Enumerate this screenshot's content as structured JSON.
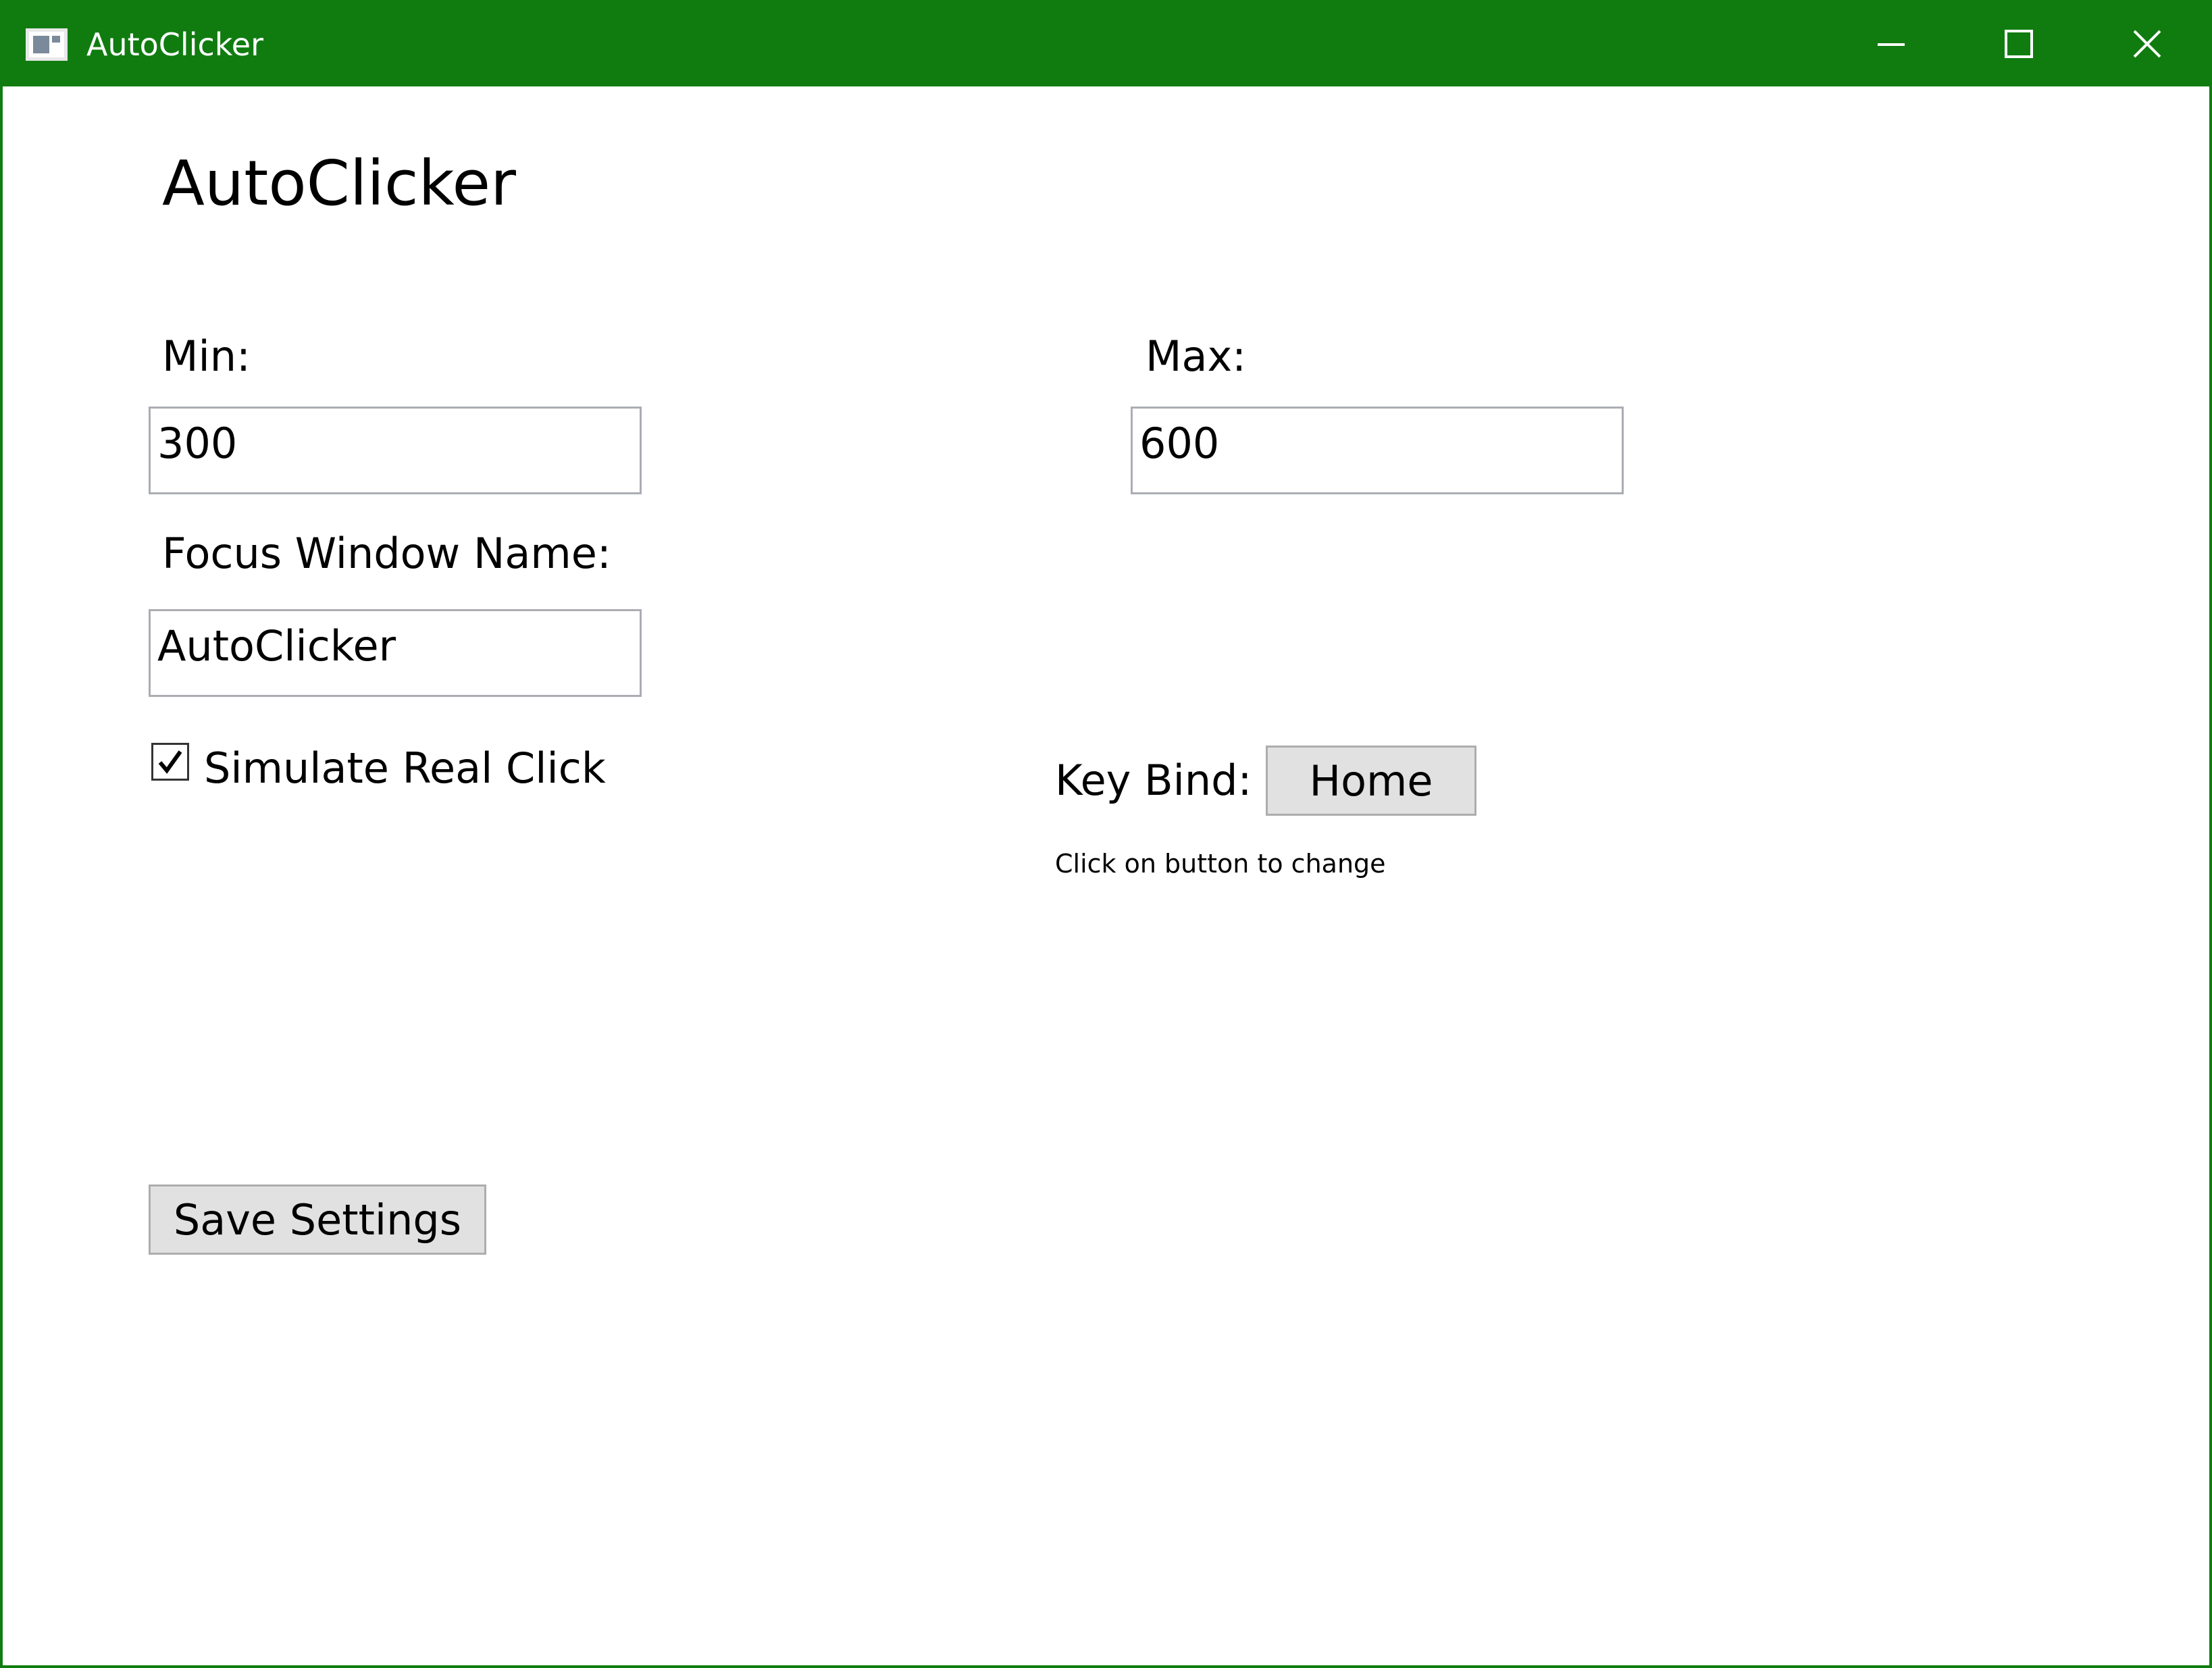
{
  "window": {
    "title": "AutoClicker",
    "app_icon": "window-app-icon",
    "controls": {
      "minimize_icon": "minimize-icon",
      "maximize_icon": "maximize-icon",
      "close_icon": "close-icon"
    },
    "titlebar_color": "#107c10"
  },
  "main": {
    "heading": "AutoClicker",
    "min": {
      "label": "Min:",
      "value": "300"
    },
    "max": {
      "label": "Max:",
      "value": "600"
    },
    "focus_window": {
      "label": "Focus Window Name:",
      "value": "AutoClicker"
    },
    "simulate_click": {
      "label": "Simulate Real Click",
      "checked": true
    },
    "key_bind": {
      "label": "Key Bind:",
      "button_label": "Home",
      "hint": "Click on button to change"
    },
    "save_button": "Save Settings"
  }
}
